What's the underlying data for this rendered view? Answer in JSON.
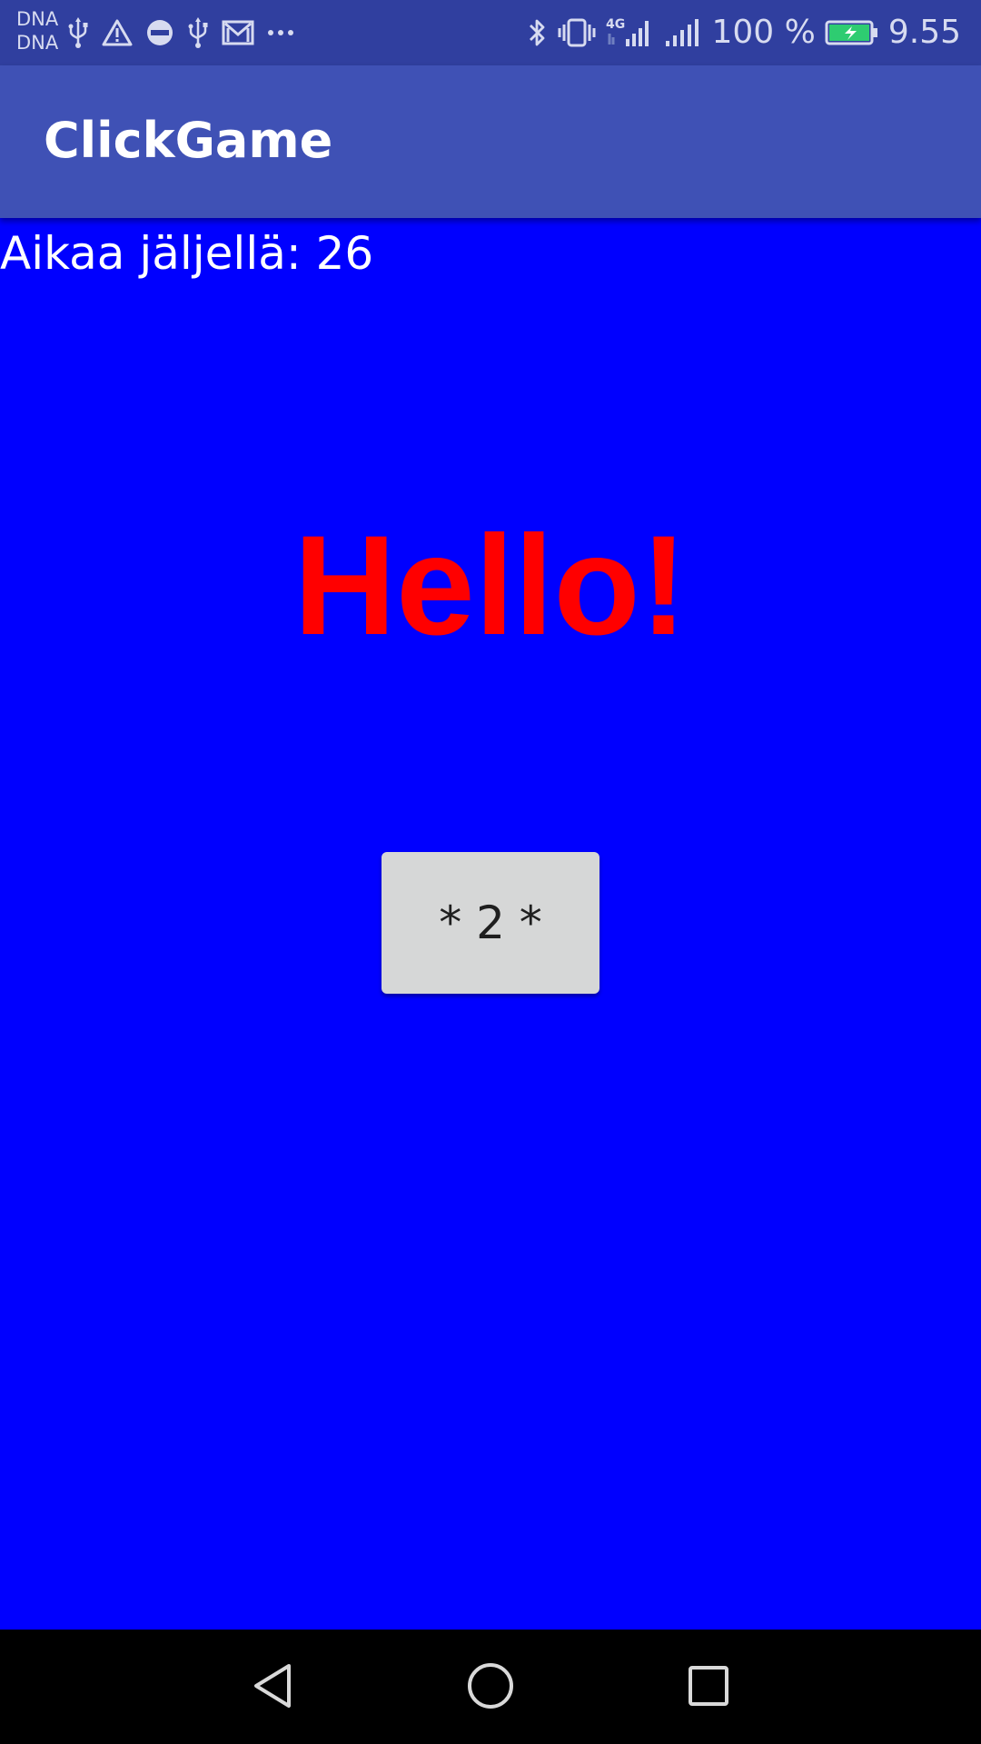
{
  "status_bar": {
    "carrier_line1": "DNA",
    "carrier_line2": "DNA",
    "battery_percent": "100 %",
    "time": "9.55",
    "left_icons": [
      "usb-icon",
      "warning-icon",
      "do-not-disturb-icon",
      "usb-icon",
      "gmail-icon",
      "more-dots-icon"
    ],
    "right_icons": [
      "bluetooth-icon",
      "vibrate-icon",
      "signal-4g-icon",
      "signal-icon",
      "battery-charging-icon"
    ],
    "battery_color": "#2ecc71"
  },
  "app_bar": {
    "title": "ClickGame",
    "color": "#3f51b5"
  },
  "main": {
    "timer_text": "Aikaa jäljellä: 26",
    "hello_text": "Hello!",
    "button_label": "* 2 *",
    "background_color": "#0000ff",
    "hello_color": "#ff0000"
  },
  "nav_bar": {
    "buttons": [
      "back-icon",
      "home-icon",
      "recents-icon"
    ]
  }
}
